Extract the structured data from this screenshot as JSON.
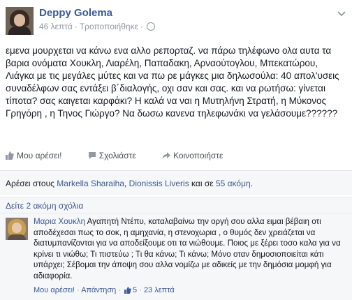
{
  "post": {
    "author": "Deppy Golema",
    "time": "46 λεπτά",
    "edited": "Τροποποιήθηκε",
    "text": "εμενα μουρχεται να κάνω ενα αλλο ρεπορταζ. να πάρω τηλέφωνο ολα αυτα τα βαρια ονόματα Χουκλη, Λιαρέλη, Παπαδακη, Αρναούτογλου, Μπεκατώρου, Λιάγκα με τις μεγάλες μύτες και να πω ρε μάγκες μια δηλωσούλα: 40 απολ'υσεις συναδέλφων σας εντάξει β΄διαλογής, οχι σαν και σας. και να ρωτήσω: γίνεται τίποτα? σας καιγεται καρφάκι? Η καλά να ναι η Μυτηλήνη Στρατή, η Μύκονος Γρηγόρη , η Τηνος Γιώργο? Να δωσω κανενα τηλεφωνάκι να γελάσουμε??????"
  },
  "actions": {
    "like": "Μου αρέσει!",
    "comment": "Σχολιάστε",
    "share": "Κοινοποιήστε"
  },
  "likes": {
    "prefix": "Αρέσει στους",
    "name1": "Markella Sharaiha",
    "name2": "Dionissis Liveris",
    "middle": "και σε",
    "more": "55 ακόμη"
  },
  "comments": {
    "view_more": "Δείτε 2 ακόμη σχόλια",
    "items": [
      {
        "author": "Μαρια Χουκλη",
        "text": "Αγαπητή Ντέπυ, καταλαβαίνω την οργή σου αλλα ειμαι βέβαιη οτι αποδέχεσαι πως το σοκ, η αμηχανία, η στενοχωρια , ο θυμός δεν χρειάζεται να διατυμπανίζονται για να αποδείξουμε οτι τα νιώθουμε. Ποιος με ξέρει τοσο καλα για να κρίνει τι νιώθω; Τι πιστεύω ; Τι θα κάνω; Τι κάνω; Μόνο οταν δημοσιοποιείται κάτι υπάρχει; Σέβομαι την άποψη σου αλλα νομίζω με αδικείς με την δημόσια μομφή για αδιαφορία.",
        "like": "Μου αρέσει!",
        "reply": "Απάντηση",
        "likes": "5",
        "time": "23 λεπτά"
      }
    ]
  }
}
